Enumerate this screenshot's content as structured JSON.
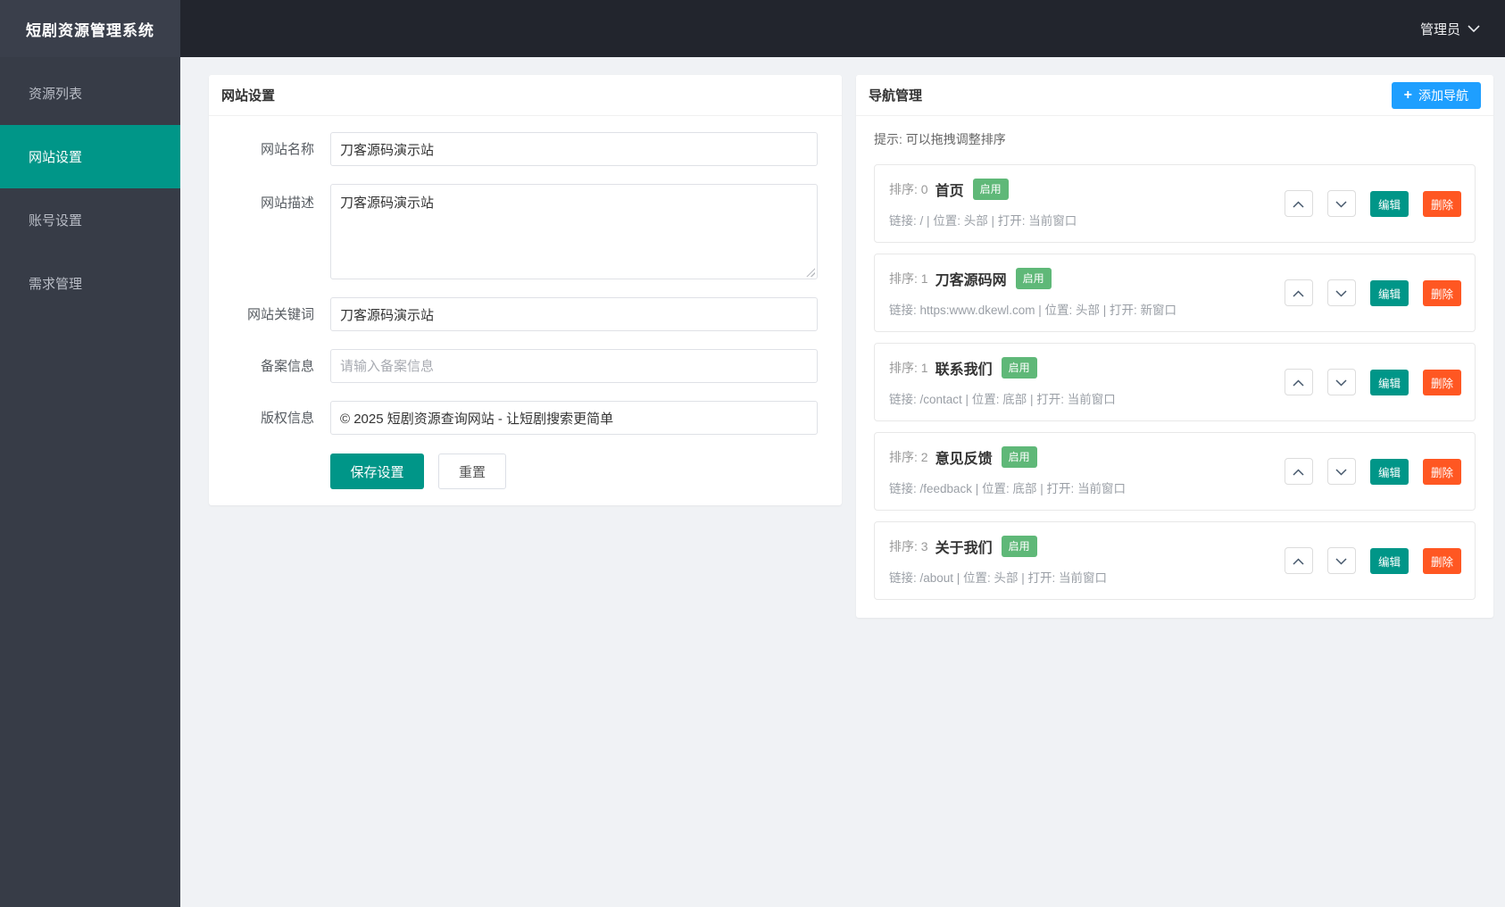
{
  "app": {
    "title": "短剧资源管理系统",
    "user_menu": "管理员"
  },
  "sidebar": {
    "items": [
      {
        "label": "资源列表",
        "active": false
      },
      {
        "label": "网站设置",
        "active": true
      },
      {
        "label": "账号设置",
        "active": false
      },
      {
        "label": "需求管理",
        "active": false
      }
    ]
  },
  "site_settings": {
    "card_title": "网站设置",
    "fields": {
      "name": {
        "label": "网站名称",
        "value": "刀客源码演示站"
      },
      "description": {
        "label": "网站描述",
        "value": "刀客源码演示站"
      },
      "keywords": {
        "label": "网站关键词",
        "value": "刀客源码演示站"
      },
      "icp": {
        "label": "备案信息",
        "value": "",
        "placeholder": "请输入备案信息"
      },
      "copyright": {
        "label": "版权信息",
        "value": "© 2025 短剧资源查询网站 - 让短剧搜索更简单"
      }
    },
    "save_label": "保存设置",
    "reset_label": "重置"
  },
  "nav_management": {
    "card_title": "导航管理",
    "add_button_label": "添加导航",
    "add_button_plus": "+",
    "hint": "提示: 可以拖拽调整排序",
    "edit_label": "编辑",
    "delete_label": "删除",
    "items": [
      {
        "order": "排序: 0",
        "title": "首页",
        "status": "启用",
        "meta": "链接: / | 位置: 头部 | 打开: 当前窗口"
      },
      {
        "order": "排序: 1",
        "title": "刀客源码网",
        "status": "启用",
        "meta": "链接: https:www.dkewl.com | 位置: 头部 | 打开: 新窗口"
      },
      {
        "order": "排序: 1",
        "title": "联系我们",
        "status": "启用",
        "meta": "链接: /contact | 位置: 底部 | 打开: 当前窗口"
      },
      {
        "order": "排序: 2",
        "title": "意见反馈",
        "status": "启用",
        "meta": "链接: /feedback | 位置: 底部 | 打开: 当前窗口"
      },
      {
        "order": "排序: 3",
        "title": "关于我们",
        "status": "启用",
        "meta": "链接: /about | 位置: 头部 | 打开: 当前窗口"
      }
    ]
  },
  "colors": {
    "accent_teal": "#009688",
    "add_blue": "#1E9FFF",
    "delete_red": "#FF5722",
    "badge_green": "#5FB878",
    "topbar_dark": "#22252d",
    "sidebar_dark": "#373c47"
  }
}
